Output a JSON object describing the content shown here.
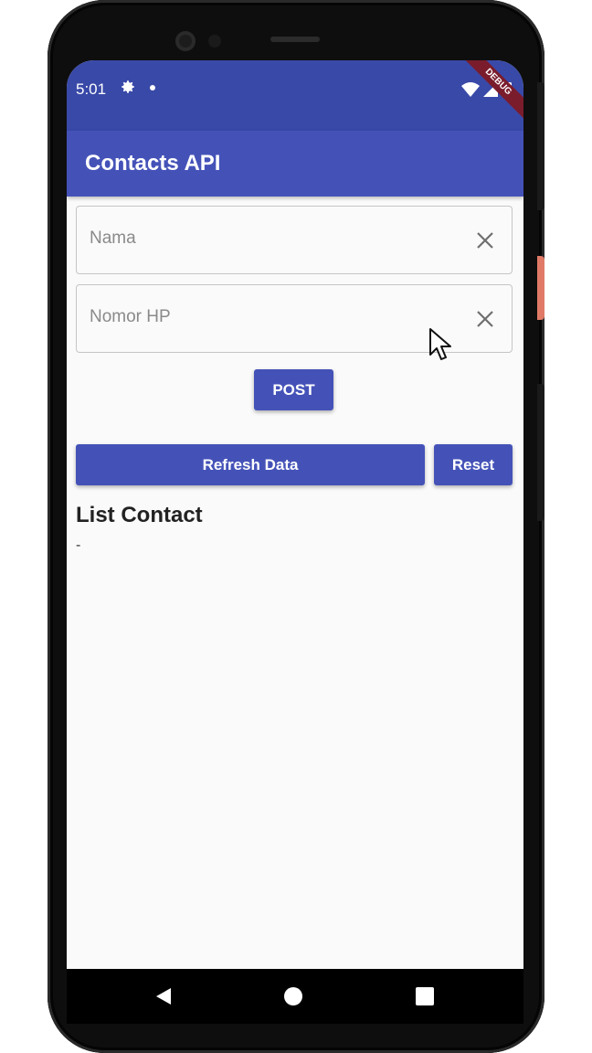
{
  "statusbar": {
    "time": "5:01",
    "debug_banner": "DEBUG"
  },
  "appbar": {
    "title": "Contacts API"
  },
  "form": {
    "name_placeholder": "Nama",
    "name_value": "",
    "phone_placeholder": "Nomor HP",
    "phone_value": "",
    "post_label": "POST"
  },
  "actions": {
    "refresh_label": "Refresh Data",
    "reset_label": "Reset"
  },
  "list": {
    "heading": "List Contact",
    "empty_text": "-"
  },
  "colors": {
    "primary": "#4452b8",
    "statusbar": "#3949a8",
    "background": "#fafafa"
  }
}
